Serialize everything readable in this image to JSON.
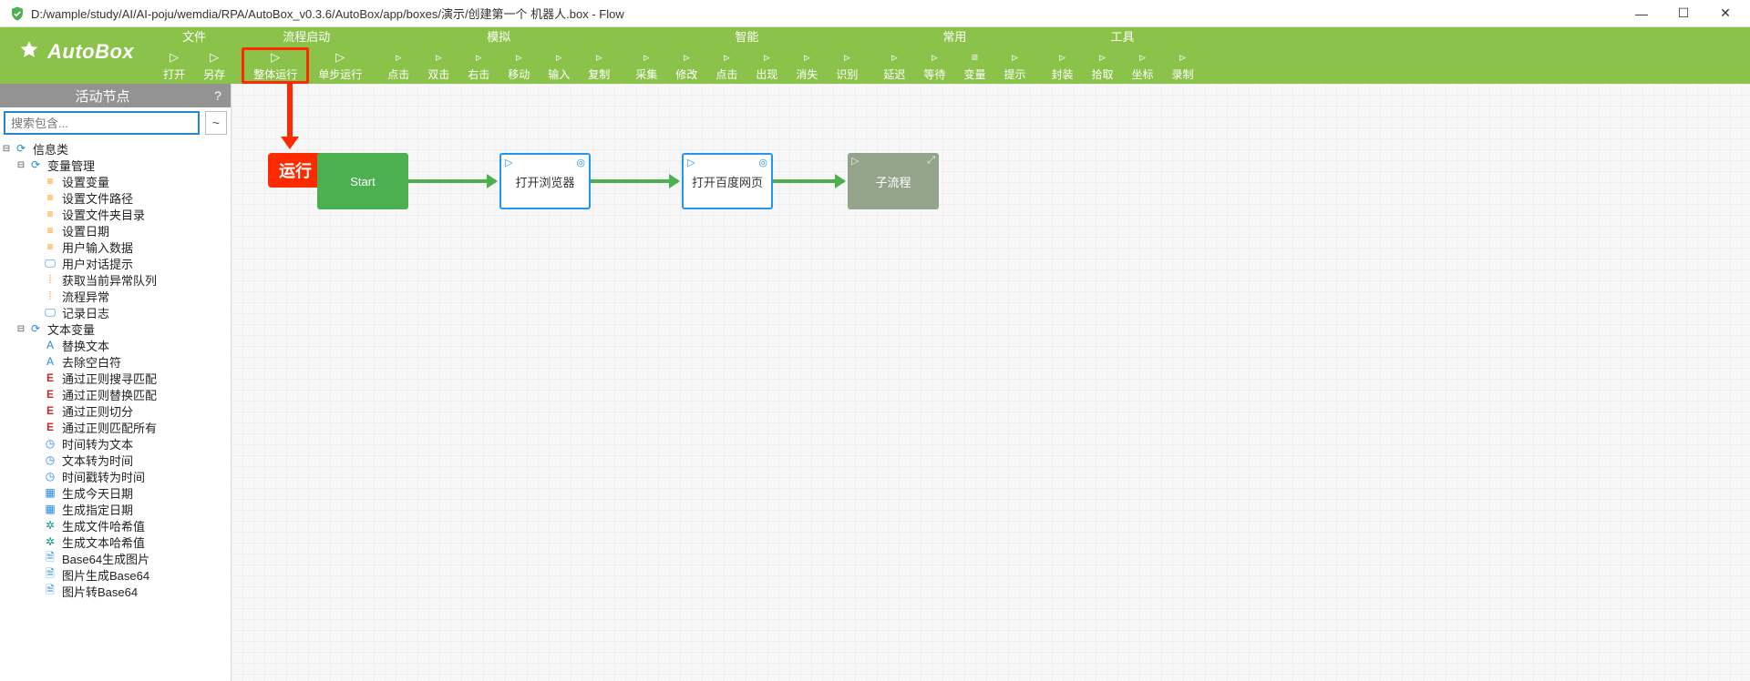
{
  "window": {
    "title": "D:/wample/study/AI/AI-poju/wemdia/RPA/AutoBox_v0.3.6/AutoBox/app/boxes/演示/创建第一个 机器人.box - Flow"
  },
  "logo": {
    "name": "AutoBox"
  },
  "ribbon": {
    "groups": [
      {
        "title": "文件",
        "items": [
          {
            "icon": "▷",
            "label": "打开"
          },
          {
            "icon": "▷",
            "label": "另存"
          }
        ]
      },
      {
        "title": "流程启动",
        "items": [
          {
            "icon": "▷",
            "label": "整体运行",
            "highlight": true
          },
          {
            "icon": "▷",
            "label": "单步运行"
          }
        ]
      },
      {
        "title": "模拟",
        "items": [
          {
            "icon": "▹",
            "label": "点击"
          },
          {
            "icon": "▹",
            "label": "双击"
          },
          {
            "icon": "▹",
            "label": "右击"
          },
          {
            "icon": "▹",
            "label": "移动"
          },
          {
            "icon": "▹",
            "label": "输入"
          },
          {
            "icon": "▹",
            "label": "复制"
          }
        ]
      },
      {
        "title": "智能",
        "items": [
          {
            "icon": "▹",
            "label": "采集"
          },
          {
            "icon": "▹",
            "label": "修改"
          },
          {
            "icon": "▹",
            "label": "点击"
          },
          {
            "icon": "▹",
            "label": "出现"
          },
          {
            "icon": "▹",
            "label": "消失"
          },
          {
            "icon": "▹",
            "label": "识别"
          }
        ]
      },
      {
        "title": "常用",
        "items": [
          {
            "icon": "▹",
            "label": "延迟"
          },
          {
            "icon": "▹",
            "label": "等待"
          },
          {
            "icon": "≡",
            "label": "变量"
          },
          {
            "icon": "▹",
            "label": "提示"
          }
        ]
      },
      {
        "title": "工具",
        "items": [
          {
            "icon": "▹",
            "label": "封装"
          },
          {
            "icon": "▹",
            "label": "拾取"
          },
          {
            "icon": "▹",
            "label": "坐标"
          },
          {
            "icon": "▹",
            "label": "录制"
          }
        ]
      }
    ]
  },
  "sidebar": {
    "title": "活动节点",
    "help": "?",
    "search_placeholder": "搜索包含...",
    "tilde": "~"
  },
  "tree": [
    {
      "indent": 0,
      "twist": "⊟",
      "iconTxt": "⟳",
      "iconCls": "blue",
      "label": "信息类"
    },
    {
      "indent": 1,
      "twist": "⊟",
      "iconTxt": "⟳",
      "iconCls": "blue",
      "label": "变量管理"
    },
    {
      "indent": 2,
      "twist": "",
      "iconTxt": "≡",
      "iconCls": "orange",
      "label": "设置变量"
    },
    {
      "indent": 2,
      "twist": "",
      "iconTxt": "≡",
      "iconCls": "orange",
      "label": "设置文件路径"
    },
    {
      "indent": 2,
      "twist": "",
      "iconTxt": "≡",
      "iconCls": "orange",
      "label": "设置文件夹目录"
    },
    {
      "indent": 2,
      "twist": "",
      "iconTxt": "≡",
      "iconCls": "orange",
      "label": "设置日期"
    },
    {
      "indent": 2,
      "twist": "",
      "iconTxt": "≡",
      "iconCls": "orange",
      "label": "用户输入数据"
    },
    {
      "indent": 2,
      "twist": "",
      "iconTxt": "🖵",
      "iconCls": "blue",
      "label": "用户对话提示"
    },
    {
      "indent": 2,
      "twist": "",
      "iconTxt": "⦙",
      "iconCls": "orange",
      "label": "获取当前异常队列"
    },
    {
      "indent": 2,
      "twist": "",
      "iconTxt": "⦙",
      "iconCls": "orange",
      "label": "流程异常"
    },
    {
      "indent": 2,
      "twist": "",
      "iconTxt": "🖵",
      "iconCls": "blue",
      "label": "记录日志"
    },
    {
      "indent": 1,
      "twist": "⊟",
      "iconTxt": "⟳",
      "iconCls": "blue",
      "label": "文本变量"
    },
    {
      "indent": 2,
      "twist": "",
      "iconTxt": "A",
      "iconCls": "blue",
      "label": "替换文本"
    },
    {
      "indent": 2,
      "twist": "",
      "iconTxt": "A",
      "iconCls": "blue",
      "label": "去除空白符"
    },
    {
      "indent": 2,
      "twist": "",
      "iconTxt": "E",
      "iconCls": "crimson",
      "label": "通过正则搜寻匹配"
    },
    {
      "indent": 2,
      "twist": "",
      "iconTxt": "E",
      "iconCls": "crimson",
      "label": "通过正则替换匹配"
    },
    {
      "indent": 2,
      "twist": "",
      "iconTxt": "E",
      "iconCls": "crimson",
      "label": "通过正则切分"
    },
    {
      "indent": 2,
      "twist": "",
      "iconTxt": "E",
      "iconCls": "crimson",
      "label": "通过正则匹配所有"
    },
    {
      "indent": 2,
      "twist": "",
      "iconTxt": "◷",
      "iconCls": "blue",
      "label": "时间转为文本"
    },
    {
      "indent": 2,
      "twist": "",
      "iconTxt": "◷",
      "iconCls": "blue",
      "label": "文本转为时间"
    },
    {
      "indent": 2,
      "twist": "",
      "iconTxt": "◷",
      "iconCls": "blue",
      "label": "时间戳转为时间"
    },
    {
      "indent": 2,
      "twist": "",
      "iconTxt": "▦",
      "iconCls": "blue",
      "label": "生成今天日期"
    },
    {
      "indent": 2,
      "twist": "",
      "iconTxt": "▦",
      "iconCls": "blue",
      "label": "生成指定日期"
    },
    {
      "indent": 2,
      "twist": "",
      "iconTxt": "✲",
      "iconCls": "teal",
      "label": "生成文件哈希值"
    },
    {
      "indent": 2,
      "twist": "",
      "iconTxt": "✲",
      "iconCls": "teal",
      "label": "生成文本哈希值"
    },
    {
      "indent": 2,
      "twist": "",
      "iconTxt": "🗎",
      "iconCls": "blue",
      "label": "Base64生成图片"
    },
    {
      "indent": 2,
      "twist": "",
      "iconTxt": "🗎",
      "iconCls": "blue",
      "label": "图片生成Base64"
    },
    {
      "indent": 2,
      "twist": "",
      "iconTxt": "🗎",
      "iconCls": "blue",
      "label": "图片转Base64"
    }
  ],
  "annotation": {
    "run_label": "运行"
  },
  "flow": {
    "nodes": [
      {
        "id": "start",
        "type": "start",
        "label": "Start"
      },
      {
        "id": "n1",
        "type": "step",
        "label": "打开浏览器"
      },
      {
        "id": "n2",
        "type": "step",
        "label": "打开百度网页"
      },
      {
        "id": "n3",
        "type": "sub",
        "label": "子流程"
      }
    ]
  }
}
